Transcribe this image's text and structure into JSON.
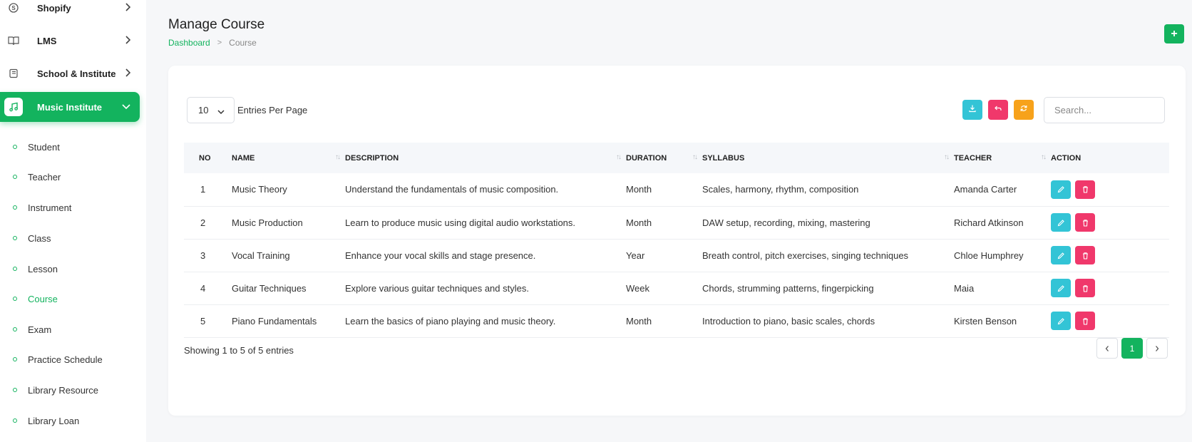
{
  "sidebar": {
    "menu": [
      {
        "label": "Shopify",
        "icon": "shopify-icon",
        "active": false
      },
      {
        "label": "LMS",
        "icon": "book-icon",
        "active": false
      },
      {
        "label": "School & Institute",
        "icon": "notebook-icon",
        "active": false
      },
      {
        "label": "Music Institute",
        "icon": "music-note-icon",
        "active": true
      }
    ],
    "submenu": [
      {
        "label": "Student",
        "active": false
      },
      {
        "label": "Teacher",
        "active": false
      },
      {
        "label": "Instrument",
        "active": false
      },
      {
        "label": "Class",
        "active": false
      },
      {
        "label": "Lesson",
        "active": false
      },
      {
        "label": "Course",
        "active": true
      },
      {
        "label": "Exam",
        "active": false
      },
      {
        "label": "Practice Schedule",
        "active": false
      },
      {
        "label": "Library Resource",
        "active": false
      },
      {
        "label": "Library Loan",
        "active": false
      }
    ]
  },
  "header": {
    "title": "Manage Course",
    "breadcrumb": {
      "link": "Dashboard",
      "separator": ">",
      "current": "Course"
    },
    "add_label": "+"
  },
  "toolbar": {
    "entries_value": "10",
    "entries_label": "Entries Per Page",
    "search_placeholder": "Search..."
  },
  "table": {
    "columns": [
      "NO",
      "NAME",
      "DESCRIPTION",
      "DURATION",
      "SYLLABUS",
      "TEACHER",
      "ACTION"
    ],
    "sort_glyph": "↑↓",
    "rows": [
      {
        "no": "1",
        "name": "Music Theory",
        "description": "Understand the fundamentals of music composition.",
        "duration": "Month",
        "syllabus": "Scales, harmony, rhythm, composition",
        "teacher": "Amanda Carter"
      },
      {
        "no": "2",
        "name": "Music Production",
        "description": "Learn to produce music using digital audio workstations.",
        "duration": "Month",
        "syllabus": "DAW setup, recording, mixing, mastering",
        "teacher": "Richard Atkinson"
      },
      {
        "no": "3",
        "name": "Vocal Training",
        "description": "Enhance your vocal skills and stage presence.",
        "duration": "Year",
        "syllabus": "Breath control, pitch exercises, singing techniques",
        "teacher": "Chloe Humphrey"
      },
      {
        "no": "4",
        "name": "Guitar Techniques",
        "description": "Explore various guitar techniques and styles.",
        "duration": "Week",
        "syllabus": "Chords, strumming patterns, fingerpicking",
        "teacher": "Maia"
      },
      {
        "no": "5",
        "name": "Piano Fundamentals",
        "description": "Learn the basics of piano playing and music theory.",
        "duration": "Month",
        "syllabus": "Introduction to piano, basic scales, chords",
        "teacher": "Kirsten Benson"
      }
    ]
  },
  "footer": {
    "showing": "Showing 1 to 5 of 5 entries",
    "current_page": "1"
  },
  "colors": {
    "primary": "#13b35e",
    "download": "#33c4d6",
    "undo": "#f0386b",
    "refresh": "#f7a21b",
    "edit": "#33c4d6",
    "delete": "#f0386b"
  }
}
